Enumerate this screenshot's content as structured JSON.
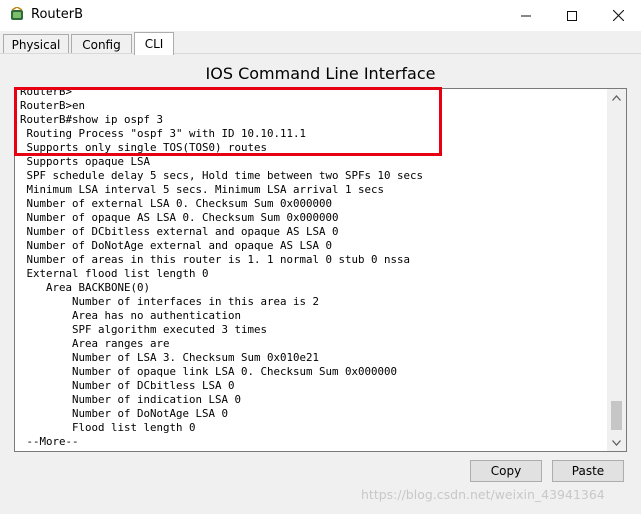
{
  "window": {
    "title": "RouterB",
    "app_icon": "cisco-device-icon"
  },
  "tabs": [
    {
      "label": "Physical",
      "active": false
    },
    {
      "label": "Config",
      "active": false
    },
    {
      "label": "CLI",
      "active": true
    }
  ],
  "header": {
    "title": "IOS Command Line Interface"
  },
  "terminal": {
    "lines": [
      "RouterB>",
      "RouterB>en",
      "RouterB#show ip ospf 3",
      " Routing Process \"ospf 3\" with ID 10.10.11.1",
      " Supports only single TOS(TOS0) routes",
      " Supports opaque LSA",
      " SPF schedule delay 5 secs, Hold time between two SPFs 10 secs",
      " Minimum LSA interval 5 secs. Minimum LSA arrival 1 secs",
      " Number of external LSA 0. Checksum Sum 0x000000",
      " Number of opaque AS LSA 0. Checksum Sum 0x000000",
      " Number of DCbitless external and opaque AS LSA 0",
      " Number of DoNotAge external and opaque AS LSA 0",
      " Number of areas in this router is 1. 1 normal 0 stub 0 nssa",
      " External flood list length 0",
      "    Area BACKBONE(0)",
      "        Number of interfaces in this area is 2",
      "        Area has no authentication",
      "        SPF algorithm executed 3 times",
      "        Area ranges are",
      "        Number of LSA 3. Checksum Sum 0x010e21",
      "        Number of opaque link LSA 0. Checksum Sum 0x000000",
      "        Number of DCbitless LSA 0",
      "        Number of indication LSA 0",
      "        Number of DoNotAge LSA 0",
      "        Flood list length 0",
      " --More--"
    ]
  },
  "buttons": {
    "copy": "Copy",
    "paste": "Paste"
  },
  "watermark": "https://blog.csdn.net/weixin_43941364",
  "colors": {
    "highlight": "#e60012",
    "background": "#f0f0f0"
  }
}
